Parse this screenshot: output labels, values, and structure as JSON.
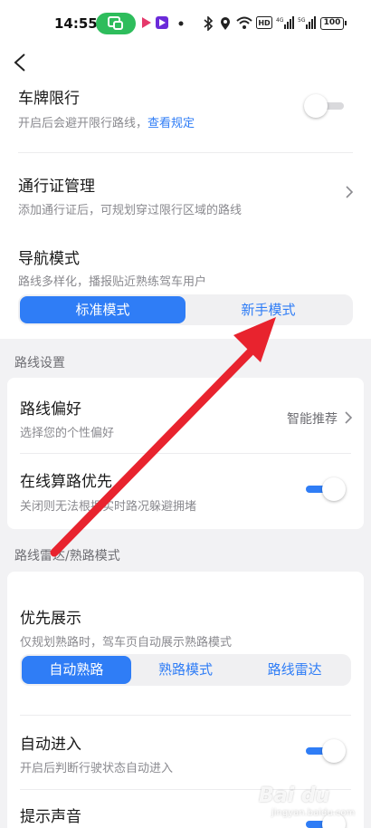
{
  "status_bar": {
    "time": "14:55",
    "battery": "100"
  },
  "header": {
    "back_icon": "chevron-left-icon"
  },
  "plate_limit": {
    "title": "车牌限行",
    "subtitle": "开启后会避开限行路线，",
    "link": "查看规定",
    "enabled": false
  },
  "pass_mgmt": {
    "title": "通行证管理",
    "subtitle": "添加通行证后，可规划穿过限行区域的路线"
  },
  "nav_mode": {
    "title": "导航模式",
    "subtitle": "路线多样化，播报贴近熟练驾车用户",
    "options": [
      "标准模式",
      "新手模式"
    ],
    "selected": 0
  },
  "route_settings": {
    "section_label": "路线设置",
    "preference": {
      "title": "路线偏好",
      "subtitle": "选择您的个性偏好",
      "value": "智能推荐"
    },
    "online_calc": {
      "title": "在线算路优先",
      "subtitle": "关闭则无法根据实时路况躲避拥堵",
      "enabled": true
    }
  },
  "radar_section": {
    "section_label": "路线雷达/熟路模式",
    "priority": {
      "title": "优先展示",
      "subtitle": "仅规划熟路时，驾车页自动展示熟路模式",
      "options": [
        "自动熟路",
        "熟路模式",
        "路线雷达"
      ],
      "selected": 0
    },
    "auto_enter": {
      "title": "自动进入",
      "subtitle": "开启后判断行驶状态自动进入",
      "enabled": true
    },
    "sound": {
      "title": "提示声音",
      "enabled": true
    }
  },
  "colors": {
    "accent": "#2f7df6",
    "arrow": "#e8232e",
    "background": "#f2f2f4"
  }
}
